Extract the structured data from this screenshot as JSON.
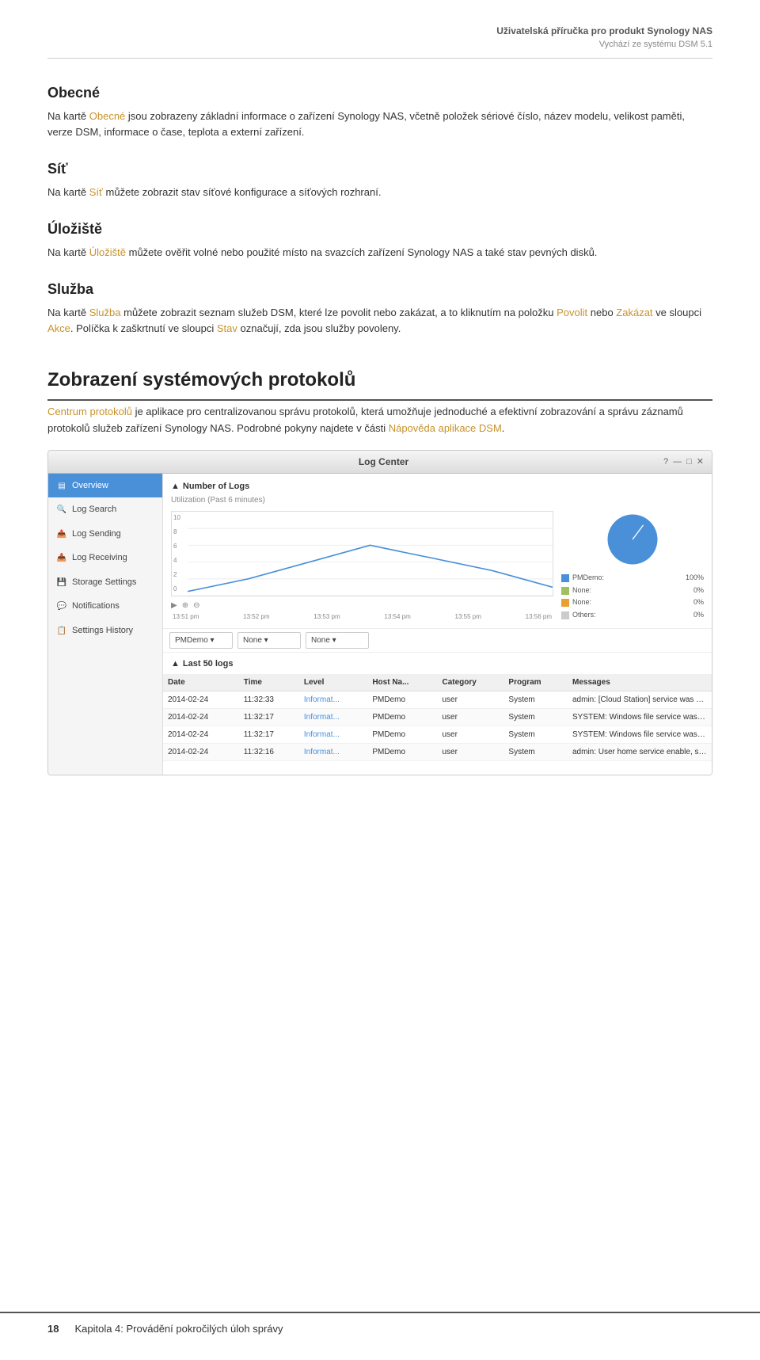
{
  "header": {
    "title": "Uživatelská příručka pro produkt Synology NAS",
    "subtitle": "Vychází ze systému DSM 5.1"
  },
  "sections": [
    {
      "id": "obecne",
      "heading": "Obecné",
      "text_parts": [
        "Na kartě ",
        "Obecné",
        " jsou zobrazeny základní informace o zařízení Synology NAS, včetně položek sériové číslo, název modelu, velikost paměti, verze DSM, informace o čase, teplota a externí zařízení."
      ]
    },
    {
      "id": "sit",
      "heading": "Síť",
      "text_parts": [
        "Na kartě ",
        "Síť",
        " můžete zobrazit stav síťové konfigurace a síťových rozhraní."
      ]
    },
    {
      "id": "uloziste",
      "heading": "Úložiště",
      "text_parts": [
        "Na kartě ",
        "Úložiště",
        " můžete ověřit volné nebo použité místo na svazcích zařízení Synology NAS a také stav pevných disků."
      ]
    },
    {
      "id": "sluzba",
      "heading": "Služba",
      "text_parts": [
        "Na kartě ",
        "Služba",
        " můžete zobrazit seznam služeb DSM, které lze povolit nebo zakázat, a to kliknutím na položku ",
        "Povolit",
        " nebo ",
        "Zakázat",
        " ve sloupci ",
        "Akce",
        ". Políčka k zaškrtnutí ve sloupci ",
        "Stav",
        " označují, zda jsou služby povoleny."
      ]
    }
  ],
  "big_section": {
    "heading": "Zobrazení systémových protokolů",
    "text_parts": [
      "Centrum protokolů",
      " je aplikace pro centralizovanou správu protokolů, která umožňuje jednoduché a efektivní zobrazování a správu záznamů protokolů služeb zařízení Synology NAS. Podrobné pokyny najdete v části ",
      "Nápověda aplikace DSM",
      "."
    ]
  },
  "log_center": {
    "window_title": "Log Center",
    "controls": [
      "?",
      "—",
      "□",
      "✕"
    ],
    "sidebar": {
      "items": [
        {
          "id": "overview",
          "label": "Overview",
          "active": true
        },
        {
          "id": "log_search",
          "label": "Log Search",
          "active": false
        },
        {
          "id": "log_sending",
          "label": "Log Sending",
          "active": false
        },
        {
          "id": "log_receiving",
          "label": "Log Receiving",
          "active": false
        },
        {
          "id": "storage_settings",
          "label": "Storage Settings",
          "active": false
        },
        {
          "id": "notifications",
          "label": "Notifications",
          "active": false
        },
        {
          "id": "settings_history",
          "label": "Settings History",
          "active": false
        }
      ]
    },
    "chart": {
      "title": "Number of Logs",
      "subtitle": "Utilization (Past 6 minutes)",
      "y_labels": [
        "10",
        "8",
        "6",
        "4",
        "2",
        "0"
      ],
      "x_labels": [
        "13:51 pm",
        "13:52 pm",
        "13:53 pm",
        "13:54 pm",
        "13:55 pm",
        "13:56 pm"
      ]
    },
    "dropdowns": [
      "PMDemo",
      "None",
      "None"
    ],
    "pie_legend": [
      {
        "label": "PMDemo:",
        "value": "100%",
        "color": "#4a90d9"
      },
      {
        "label": "None:",
        "value": "0%",
        "color": "#a0c060"
      },
      {
        "label": "None:",
        "value": "0%",
        "color": "#e8a030"
      },
      {
        "label": "Others:",
        "value": "0%",
        "color": "#ccc"
      }
    ],
    "logs_section": {
      "title": "Last 50 logs",
      "columns": [
        "Date",
        "Time",
        "Level",
        "Host Na...",
        "Category",
        "Program",
        "Messages"
      ],
      "rows": [
        {
          "date": "2014-02-24",
          "time": "11:32:33",
          "level": "Informat...",
          "host": "PMDemo",
          "category": "user",
          "program": "System",
          "message": "admin: [Cloud Station] service was star..."
        },
        {
          "date": "2014-02-24",
          "time": "11:32:17",
          "level": "Informat...",
          "host": "PMDemo",
          "category": "user",
          "program": "System",
          "message": "SYSTEM: Windows file service was start..."
        },
        {
          "date": "2014-02-24",
          "time": "11:32:17",
          "level": "Informat...",
          "host": "PMDemo",
          "category": "user",
          "program": "System",
          "message": "SYSTEM: Windows file service was stop..."
        },
        {
          "date": "2014-02-24",
          "time": "11:32:16",
          "level": "Informat...",
          "host": "PMDemo",
          "category": "user",
          "program": "System",
          "message": "admin: User home service enable, set ..."
        }
      ]
    }
  },
  "footer": {
    "page_number": "18",
    "text": "Kapitola 4: Provádění pokročilých úloh správy"
  }
}
